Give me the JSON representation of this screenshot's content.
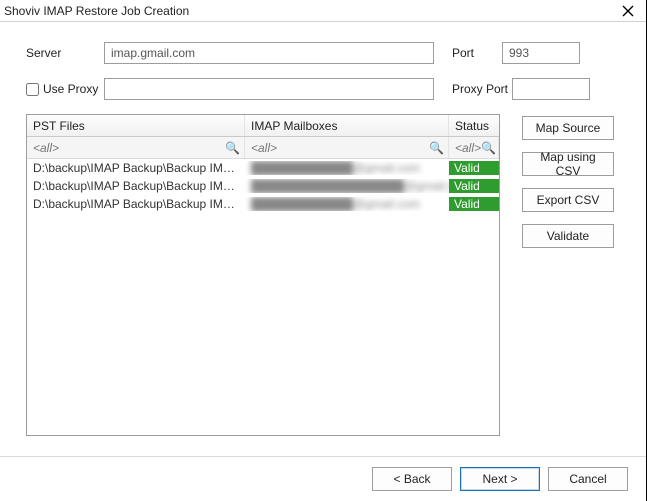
{
  "window": {
    "title": "Shoviv IMAP Restore Job Creation"
  },
  "labels": {
    "server": "Server",
    "port": "Port",
    "use_proxy": "Use Proxy",
    "proxy_port": "Proxy Port"
  },
  "fields": {
    "server": "imap.gmail.com",
    "port": "993",
    "proxy": "",
    "proxy_port": ""
  },
  "grid": {
    "headers": {
      "pst": "PST Files",
      "mbox": "IMAP Mailboxes",
      "status": "Status"
    },
    "filter_placeholder": "<all>",
    "rows": [
      {
        "pst": "D:\\backup\\IMAP Backup\\Backup IMAP ...",
        "mbox": "████████████@gmail.com",
        "status": "Valid"
      },
      {
        "pst": "D:\\backup\\IMAP Backup\\Backup IMAP ...",
        "mbox": "██████████████████@gmail.com",
        "status": "Valid"
      },
      {
        "pst": "D:\\backup\\IMAP Backup\\Backup IMAP ...",
        "mbox": "████████████@gmail.com",
        "status": "Valid"
      }
    ]
  },
  "side": {
    "map_source": "Map Source",
    "map_csv": "Map using CSV",
    "export_csv": "Export CSV",
    "validate": "Validate"
  },
  "wizard": {
    "back": "< Back",
    "next": "Next >",
    "cancel": "Cancel"
  },
  "icons": {
    "search": "🔍"
  }
}
